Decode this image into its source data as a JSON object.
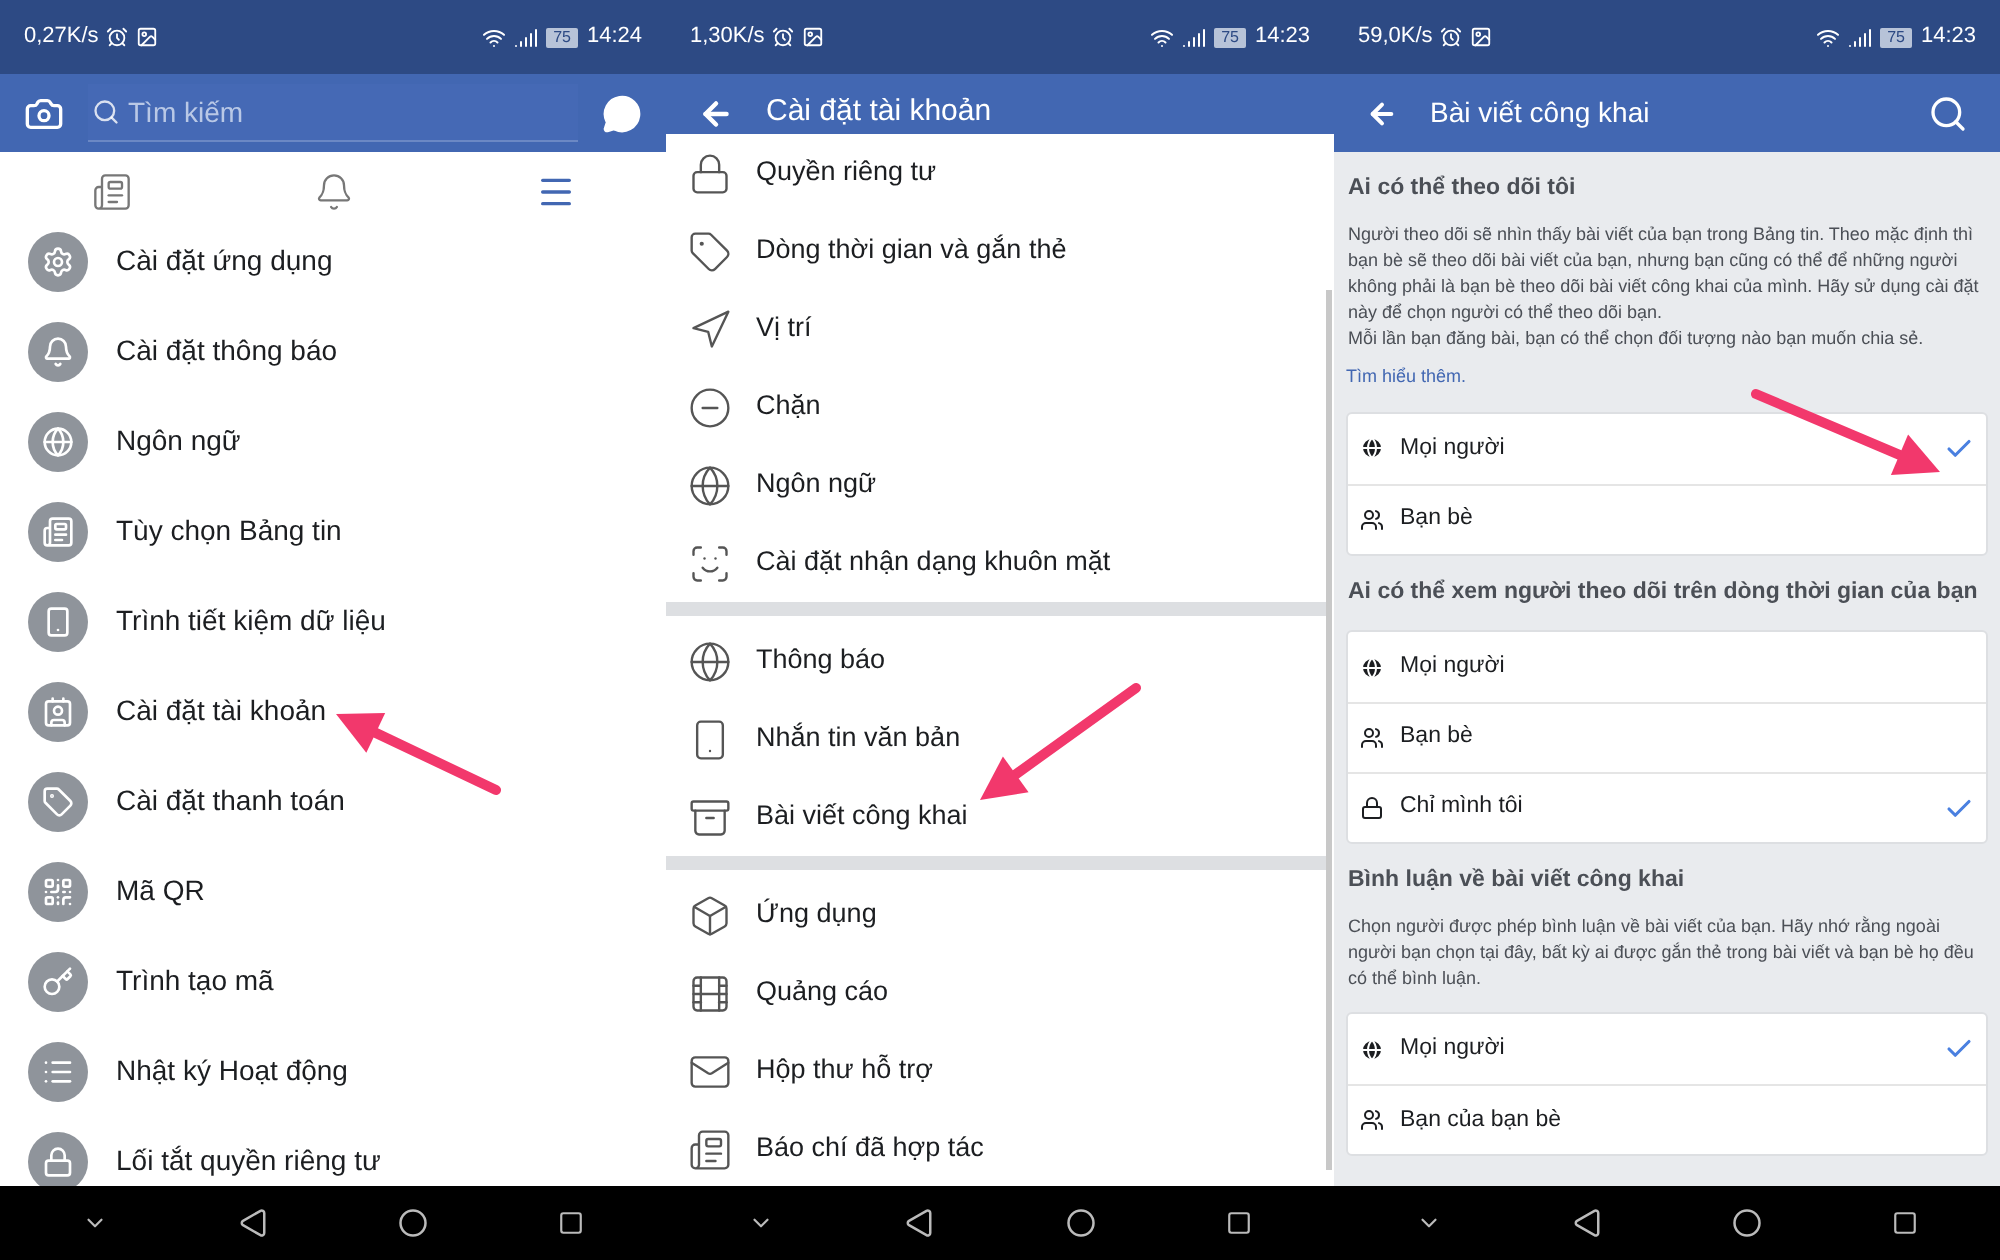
{
  "panels": [
    {
      "kind": "home",
      "status": {
        "speed": "0,27K/s",
        "battery": "75",
        "time": "14:24"
      },
      "search": {
        "placeholder": "Tìm kiếm"
      },
      "tabs": [
        {
          "selected": false
        },
        {
          "selected": false
        },
        {
          "selected": true
        }
      ],
      "items": [
        "Cài đặt ứng dụng",
        "Cài đặt thông báo",
        "Ngôn ngữ",
        "Tùy chọn Bảng tin",
        "Trình tiết kiệm dữ liệu",
        "Cài đặt tài khoản",
        "Cài đặt thanh toán",
        "Mã QR",
        "Trình tạo mã",
        "Nhật ký Hoạt động",
        "Lối tắt quyền riêng tư"
      ]
    },
    {
      "kind": "settings",
      "status": {
        "speed": "1,30K/s",
        "battery": "75",
        "time": "14:23"
      },
      "title": "Cài đặt tài khoản",
      "groups": [
        [
          "Quyền riêng tư",
          "Dòng thời gian và gắn thẻ",
          "Vị trí",
          "Chặn",
          "Ngôn ngữ",
          "Cài đặt nhận dạng khuôn mặt"
        ],
        [
          "Thông báo",
          "Nhắn tin văn bản",
          "Bài viết công khai"
        ],
        [
          "Ứng dụng",
          "Quảng cáo",
          "Hộp thư hỗ trợ",
          "Báo chí đã hợp tác"
        ]
      ]
    },
    {
      "kind": "public_posts",
      "status": {
        "speed": "59,0K/s",
        "battery": "75",
        "time": "14:23"
      },
      "title": "Bài viết công khai",
      "sections": [
        {
          "heading": "Ai có thể theo dõi tôi",
          "paragraphs": [
            "Người theo dõi sẽ nhìn thấy bài viết của bạn trong Bảng tin. Theo mặc định thì bạn bè sẽ theo dõi bài viết của bạn, nhưng bạn cũng có thể để những người không phải là bạn bè theo dõi bài viết công khai của mình. Hãy sử dụng cài đặt này để chọn người có thể theo dõi bạn.",
            "Mỗi lần bạn đăng bài, bạn có thể chọn đối tượng nào bạn muốn chia sẻ."
          ],
          "link": "Tìm hiểu thêm.",
          "options": [
            {
              "kind": "public",
              "label": "Mọi người",
              "selected": true
            },
            {
              "kind": "friends",
              "label": "Bạn bè",
              "selected": false
            }
          ]
        },
        {
          "heading": "Ai có thể xem người theo dõi trên dòng thời gian của bạn",
          "options": [
            {
              "kind": "public",
              "label": "Mọi người",
              "selected": false
            },
            {
              "kind": "friends",
              "label": "Bạn bè",
              "selected": false
            },
            {
              "kind": "only_me",
              "label": "Chỉ mình tôi",
              "selected": true
            }
          ]
        },
        {
          "heading": "Bình luận về bài viết công khai",
          "paragraphs": [
            "Chọn người được phép bình luận về bài viết của bạn. Hãy nhớ rằng ngoài người bạn chọn tại đây, bất kỳ ai được gắn thẻ trong bài viết và bạn bè họ đều có thể bình luận."
          ],
          "options": [
            {
              "kind": "public",
              "label": "Mọi người",
              "selected": true
            },
            {
              "kind": "friends_of_friends",
              "label": "Bạn của bạn bè",
              "selected": false
            }
          ]
        }
      ]
    }
  ]
}
